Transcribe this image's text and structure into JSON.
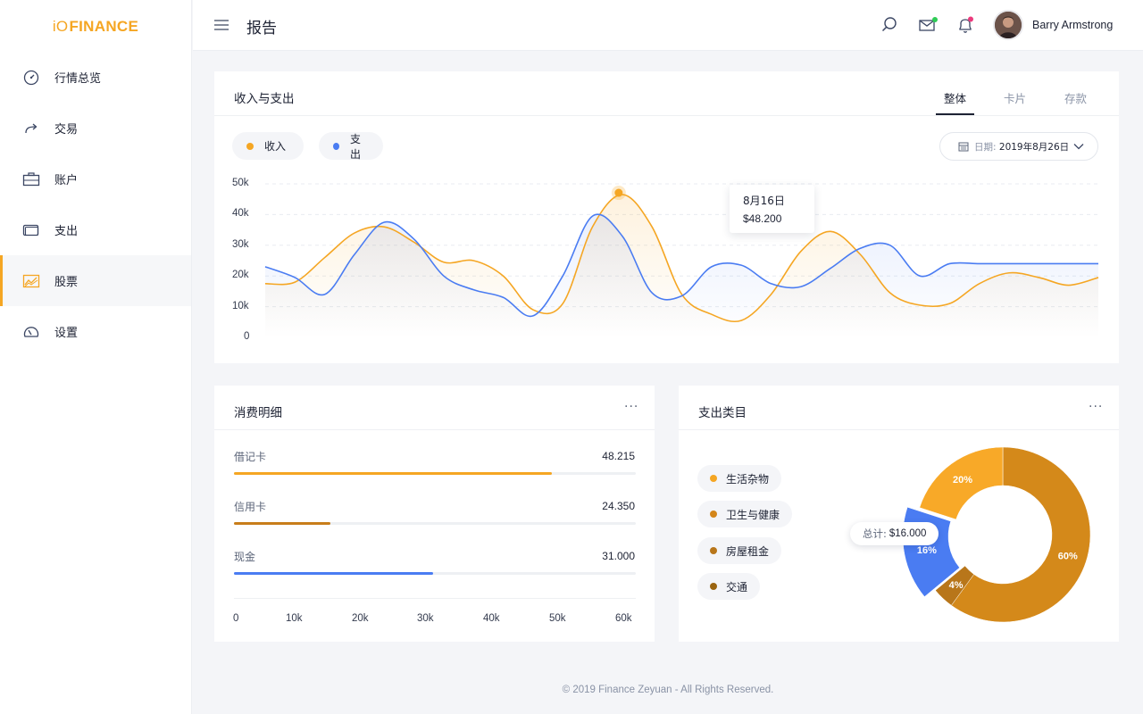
{
  "app": {
    "logo_prefix": "iO",
    "logo_text": "FINANCE"
  },
  "sidebar": {
    "items": [
      {
        "label": "行情总览",
        "icon": "gauge-icon",
        "active": false
      },
      {
        "label": "交易",
        "icon": "share-arrow-icon",
        "active": false
      },
      {
        "label": "账户",
        "icon": "briefcase-icon",
        "active": false
      },
      {
        "label": "支出",
        "icon": "wallet-icon",
        "active": false
      },
      {
        "label": "股票",
        "icon": "chart-area-icon",
        "active": true
      },
      {
        "label": "设置",
        "icon": "dashboard-icon",
        "active": false
      }
    ]
  },
  "header": {
    "title": "报告",
    "user_name": "Barry Armstrong",
    "icons": [
      "search-icon",
      "mail-icon",
      "bell-icon"
    ]
  },
  "income_card": {
    "title": "收入与支出",
    "tabs": [
      {
        "label": "整体",
        "active": true
      },
      {
        "label": "卡片",
        "active": false
      },
      {
        "label": "存款",
        "active": false
      }
    ],
    "legend": [
      {
        "label": "收入",
        "color": "#f5a623"
      },
      {
        "label": "支出",
        "color": "#4a7cf2"
      }
    ],
    "date_label": "日期:",
    "date_value": "2019年8月26日",
    "tooltip": {
      "date": "8月16日",
      "value": "$48.200"
    }
  },
  "chart_data": {
    "type": "line",
    "y_ticks": [
      "50k",
      "40k",
      "30k",
      "20k",
      "10k",
      "0"
    ],
    "ylim": [
      0,
      50000
    ],
    "x": [
      0,
      1,
      2,
      3,
      4,
      5,
      6,
      7,
      8,
      9,
      10,
      11,
      12,
      13,
      14,
      15,
      16,
      17,
      18,
      19,
      20,
      21,
      22,
      23,
      24,
      25,
      26,
      27,
      28
    ],
    "series": [
      {
        "name": "收入",
        "color": "#f5a623",
        "values": [
          17500,
          18000,
          26000,
          34000,
          36000,
          31000,
          24500,
          25000,
          20000,
          9000,
          11000,
          36000,
          46500,
          36000,
          14000,
          7500,
          5500,
          14000,
          28000,
          34500,
          27000,
          14500,
          10500,
          11000,
          17500,
          21000,
          19500,
          17000,
          19500
        ]
      },
      {
        "name": "支出",
        "color": "#4a7cf2",
        "values": [
          23000,
          19500,
          14000,
          27000,
          37500,
          32000,
          20000,
          15500,
          13000,
          7000,
          20000,
          39500,
          33000,
          14500,
          13500,
          23000,
          23500,
          17500,
          16500,
          22500,
          29000,
          30000,
          20000,
          24000,
          24000,
          24000,
          24000,
          24000,
          24000
        ]
      }
    ],
    "tooltip_point": {
      "x": 12,
      "y": 46500
    }
  },
  "spending_card": {
    "title": "消费明细",
    "bars": [
      {
        "label": "借记卡",
        "value": "48.215",
        "fraction": 0.79,
        "color": "#f5a623"
      },
      {
        "label": "信用卡",
        "value": "24.350",
        "fraction": 0.24,
        "color": "#c87d1a"
      },
      {
        "label": "现金",
        "value": "31.000",
        "fraction": 0.495,
        "color": "#4a7cf2"
      }
    ],
    "x_ticks": [
      "0",
      "10k",
      "20k",
      "30k",
      "40k",
      "50k",
      "60k"
    ]
  },
  "category_card": {
    "title": "支出类目",
    "categories": [
      {
        "label": "生活杂物",
        "color": "#f5a623"
      },
      {
        "label": "卫生与健康",
        "color": "#d4861a"
      },
      {
        "label": "房屋租金",
        "color": "#b8761a"
      },
      {
        "label": "交通",
        "color": "#9a6410"
      }
    ],
    "total_label": "总计:",
    "total_value": "$16.000",
    "donut": [
      {
        "label": "60%",
        "value": 60,
        "color": "#d4891a"
      },
      {
        "label": "4%",
        "value": 4,
        "color": "#b8761a"
      },
      {
        "label": "16%",
        "value": 16,
        "color": "#4a7cf2"
      },
      {
        "label": "20%",
        "value": 20,
        "color": "#f8a928"
      }
    ]
  },
  "footer": {
    "text": "© 2019 Finance Zeyuan - All Rights Reserved."
  }
}
